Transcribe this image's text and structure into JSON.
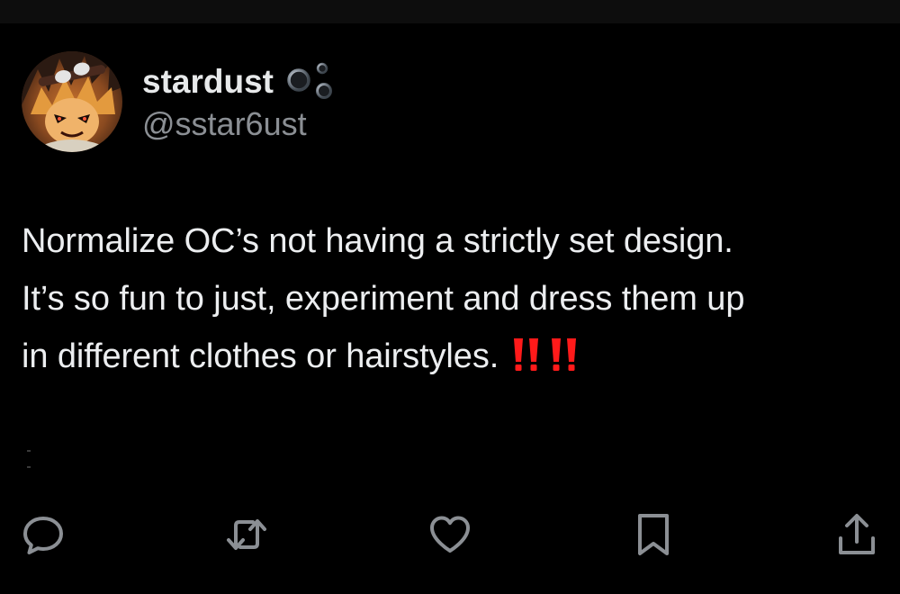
{
  "post": {
    "author": {
      "display_name": "stardust",
      "handle": "@sstar6ust",
      "name_decoration_icon": "bubbles-icon",
      "avatar_icon": "avatar"
    },
    "text_lines": [
      "Normalize OC’s not having a strictly set design.",
      "It’s so fun to just, experiment and dress them up",
      "in different clothes or hairstyles."
    ],
    "trailing_emoji": [
      "double-exclamation-icon",
      "double-exclamation-icon"
    ]
  },
  "actions": [
    {
      "name": "reply",
      "icon": "reply-icon"
    },
    {
      "name": "repost",
      "icon": "repost-icon"
    },
    {
      "name": "like",
      "icon": "heart-icon"
    },
    {
      "name": "bookmark",
      "icon": "bookmark-icon"
    },
    {
      "name": "share",
      "icon": "share-icon"
    }
  ],
  "colors": {
    "background": "#000000",
    "text_primary": "#e7e9ea",
    "text_secondary": "#8b8f94",
    "icon": "#8b8f94",
    "emoji_red": "#ff1a1a"
  }
}
